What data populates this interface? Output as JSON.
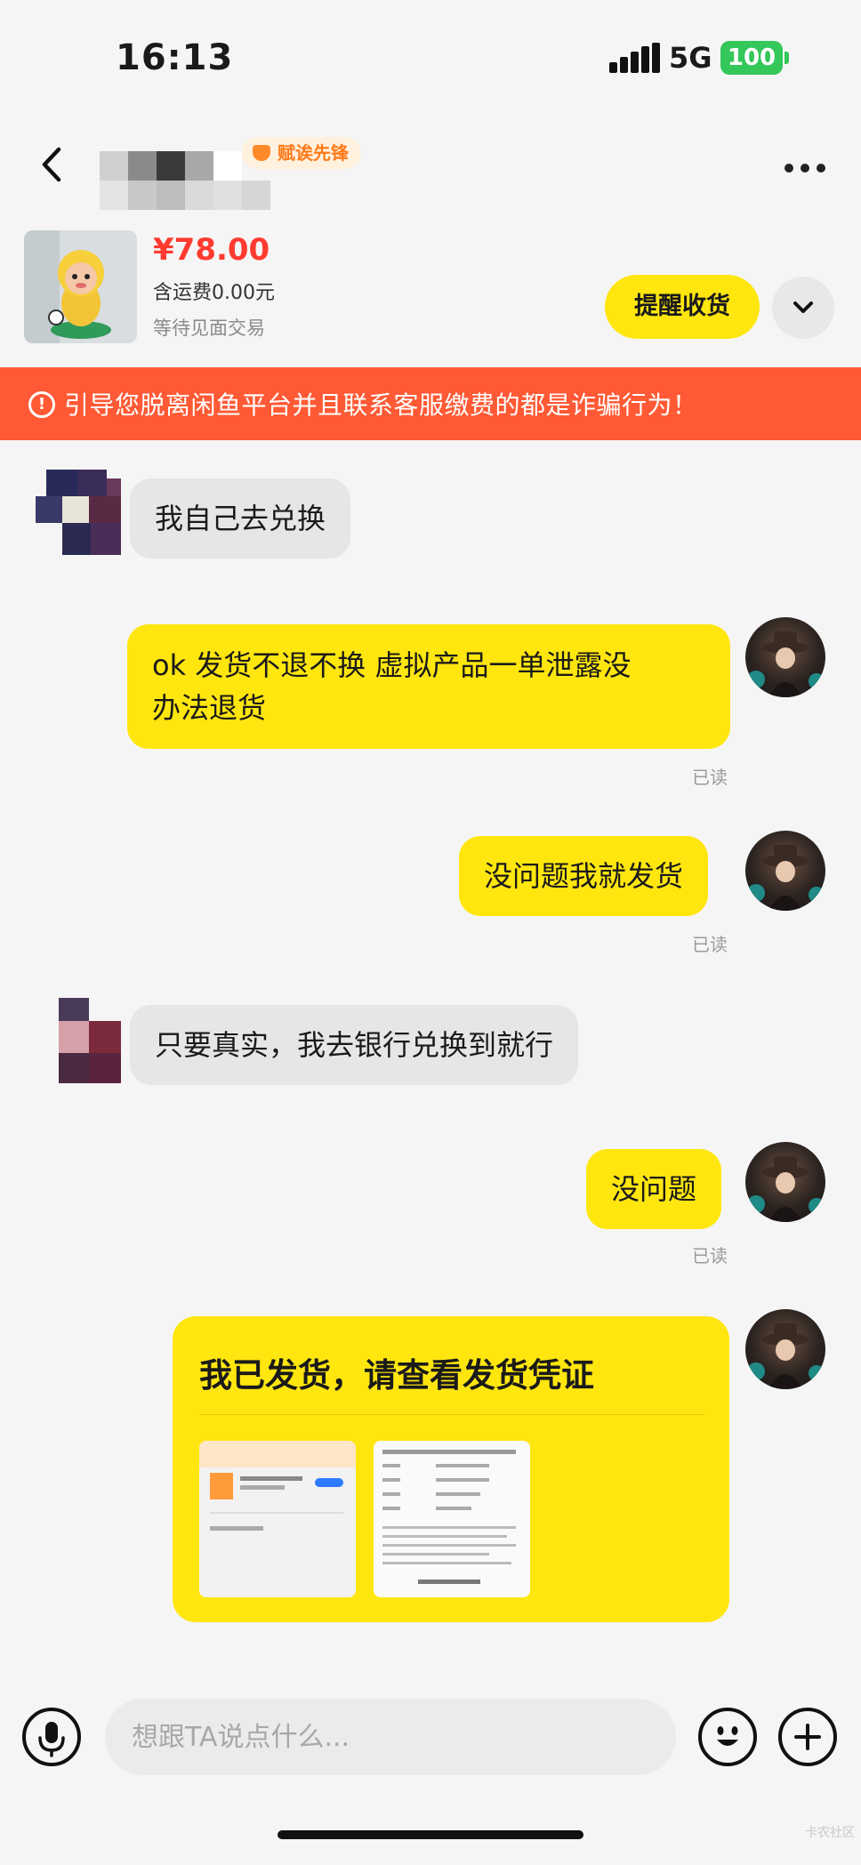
{
  "status_bar": {
    "time": "16:13",
    "network": "5G",
    "battery": "100"
  },
  "header": {
    "badge_label": "赋诶先锋"
  },
  "product": {
    "price": "¥78.00",
    "shipping": "含运费0.00元",
    "status": "等待见面交易",
    "remind_button": "提醒收货"
  },
  "warning": {
    "text": "引导您脱离闲鱼平台并且联系客服缴费的都是诈骗行为！"
  },
  "messages": [
    {
      "from": "other",
      "text": "我自己去兑换"
    },
    {
      "from": "me",
      "line1": "ok 发货不退不换 虚拟产品一单泄露没",
      "line2": "办法退货",
      "read": "已读"
    },
    {
      "from": "me",
      "text": "没问题我就发货",
      "read": "已读"
    },
    {
      "from": "other",
      "text": "只要真实，我去银行兑换到就行"
    },
    {
      "from": "me",
      "text": "没问题",
      "read": "已读"
    }
  ],
  "shipment_card": {
    "title": "我已发货，请查看发货凭证"
  },
  "composer": {
    "placeholder": "想跟TA说点什么..."
  },
  "watermark": "卡农社区",
  "colors": {
    "accent_yellow": "#ffe60f",
    "warning_orange": "#ff5a35",
    "price_red": "#ff3b30"
  }
}
